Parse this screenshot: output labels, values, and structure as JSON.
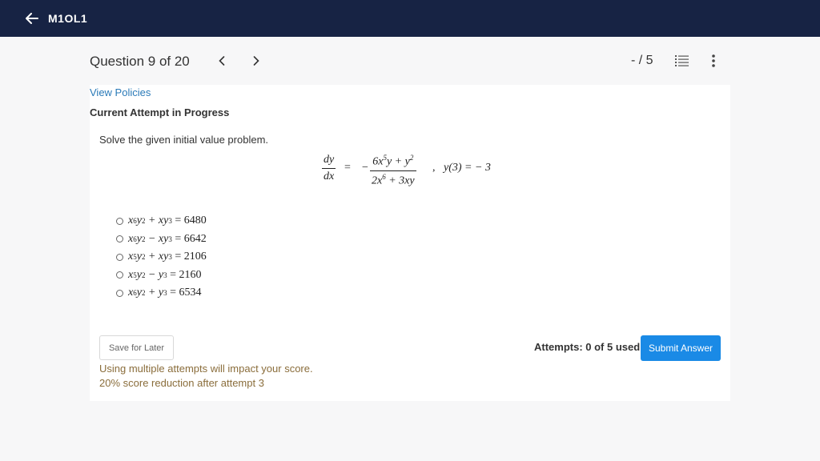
{
  "topbar": {
    "title": "M1OL1"
  },
  "header": {
    "question_label": "Question 9 of 20",
    "score": "- / 5"
  },
  "card": {
    "policies_link": "View Policies",
    "attempt_status": "Current Attempt in Progress",
    "prompt": "Solve the given initial value problem.",
    "equation": {
      "lhs_num": "dy",
      "lhs_den": "dx",
      "equals": "=",
      "minus": "−",
      "rhs_num_a": "6x",
      "rhs_num_a_exp": "5",
      "rhs_num_b": "y + y",
      "rhs_num_b_exp": "2",
      "rhs_den_a": "2x",
      "rhs_den_a_exp": "6",
      "rhs_den_b": " + 3xy",
      "comma": ",",
      "condition": "y(3) = − 3"
    },
    "options": [
      {
        "t1": "x",
        "e1": "6",
        "t2": "y",
        "e2": "2",
        "t3": " + xy",
        "e3": "3",
        "t4": " = 6480"
      },
      {
        "t1": "x",
        "e1": "6",
        "t2": "y",
        "e2": "2",
        "t3": " − xy",
        "e3": "3",
        "t4": " = 6642"
      },
      {
        "t1": "x",
        "e1": "5",
        "t2": "y",
        "e2": "2",
        "t3": " + xy",
        "e3": "3",
        "t4": " = 2106"
      },
      {
        "t1": "x",
        "e1": "5",
        "t2": "y",
        "e2": "2",
        "t3": " − y",
        "e3": "3",
        "t4": " = 2160"
      },
      {
        "t1": "x",
        "e1": "6",
        "t2": "y",
        "e2": "2",
        "t3": " + y",
        "e3": "3",
        "t4": " = 6534"
      }
    ],
    "save_label": "Save for Later",
    "warning_line1": "Using multiple attempts will impact your score.",
    "warning_line2": "20% score reduction after attempt 3",
    "attempts": "Attempts: 0 of 5 used",
    "submit_label": "Submit Answer"
  },
  "colors": {
    "topbar": "#172344",
    "link": "#2a7ab8",
    "submit": "#1a8ae6",
    "warning": "#8a6d3b"
  },
  "icons": {
    "back": "arrow-left-icon",
    "prev": "chevron-left-icon",
    "next": "chevron-right-icon",
    "list": "list-icon",
    "more": "more-vertical-icon"
  }
}
